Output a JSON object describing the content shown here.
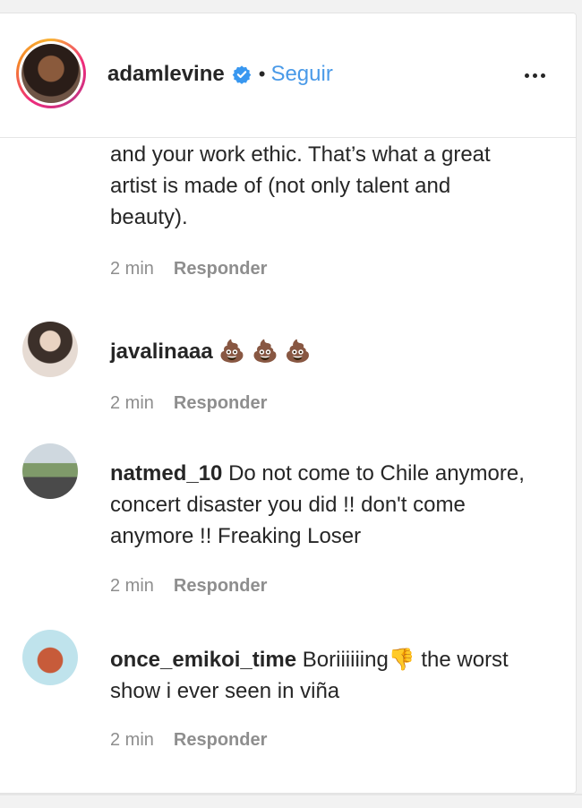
{
  "header": {
    "username": "adamlevine",
    "separator": "•",
    "follow_label": "Seguir",
    "verified_icon": "verified-badge-icon",
    "more_icon": "more-options-icon",
    "accent_color": "#4a9ae8"
  },
  "comments": [
    {
      "username": "",
      "text": "and your work ethic. That’s what a great artist is made of (not only talent and beauty).",
      "time": "2 min",
      "reply_label": "Responder"
    },
    {
      "username": "javalinaaa",
      "text": "💩 💩 💩",
      "time": "2 min",
      "reply_label": "Responder"
    },
    {
      "username": "natmed_10",
      "text": "Do not come to Chile anymore, concert disaster you did !! don't come anymore !! Freaking Loser",
      "time": "2 min",
      "reply_label": "Responder"
    },
    {
      "username": "once_emikoi_time",
      "text": "Boriiiiiing👎 the worst show i ever seen in viña",
      "time": "2 min",
      "reply_label": "Responder"
    }
  ]
}
